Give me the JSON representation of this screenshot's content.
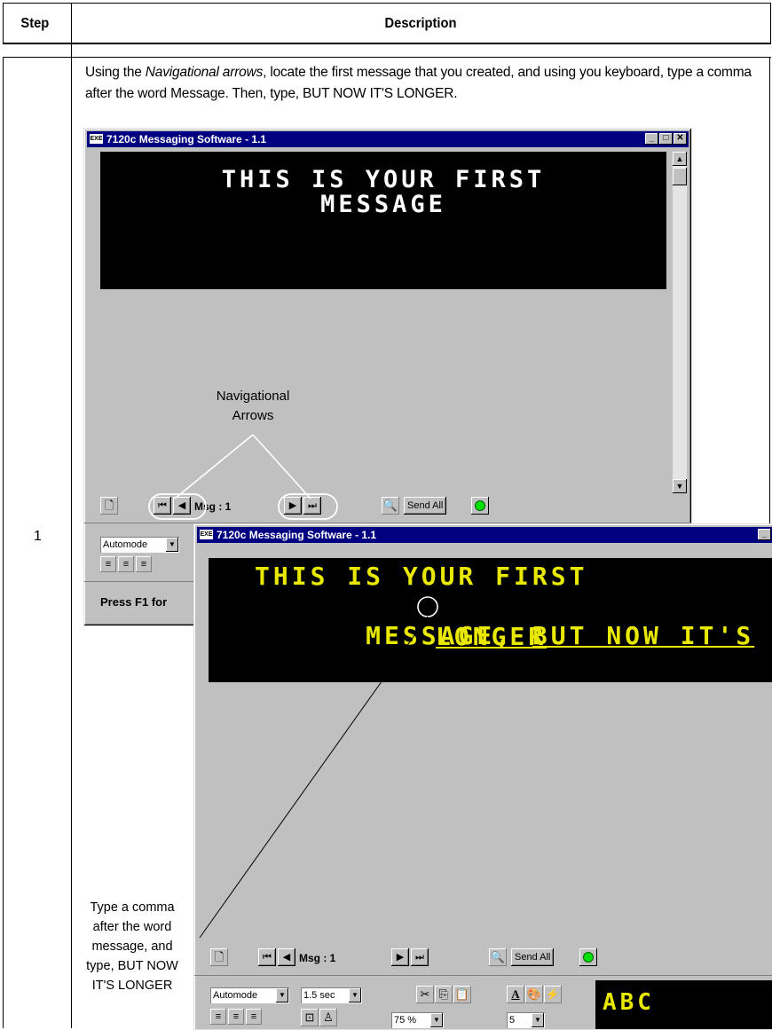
{
  "table": {
    "headers": {
      "step": "Step",
      "description": "Description"
    },
    "step_number": "1",
    "instruction_prefix": "Using the ",
    "instruction_emphasis": "Navigational arrows",
    "instruction_suffix": ", locate the first message that you created, and using you keyboard, type a comma after the word Message. Then, type, BUT NOW IT'S LONGER."
  },
  "window_back": {
    "title": "7120c  Messaging Software - 1.1",
    "app_icon": "EXE",
    "display_line1": "THIS IS YOUR FIRST",
    "display_line2": "MESSAGE",
    "display_color": "#ffffff",
    "msg_label": "Msg : 1",
    "send_all": "Send All",
    "mode_select": "Automode",
    "status_text": "Press F1 for"
  },
  "window_front": {
    "title": "7120c  Messaging Software - 1.1",
    "app_icon": "EXE",
    "display_line1": "THIS IS YOUR FIRST",
    "display_line2a": "MESSAGE",
    "display_comma": ",",
    "display_line2b": "BUT NOW IT'S",
    "display_line3": "LONGER",
    "display_color": "#e8e800",
    "msg_label": "Msg : 1",
    "send_all": "Send All",
    "mode_select": "Automode",
    "time_select": "1.5 sec",
    "zoom_select": "75 %",
    "size_select": "5",
    "preview_text": "ABC"
  },
  "annotations": {
    "nav_line1": "Navigational",
    "nav_line2": "Arrows",
    "note_line1": "Type a comma",
    "note_line2": "after the word",
    "note_line3": "message, and",
    "note_line4": "type, BUT NOW",
    "note_line5": "IT'S LONGER"
  },
  "icons": [
    "new-document-icon",
    "first-message-icon",
    "previous-message-icon",
    "next-message-icon",
    "last-message-icon",
    "preview-icon",
    "status-led-icon",
    "cut-icon",
    "copy-icon",
    "paste-icon",
    "font-icon",
    "color-icon",
    "effects-icon",
    "align-left-icon",
    "align-center-icon",
    "align-right-icon"
  ]
}
